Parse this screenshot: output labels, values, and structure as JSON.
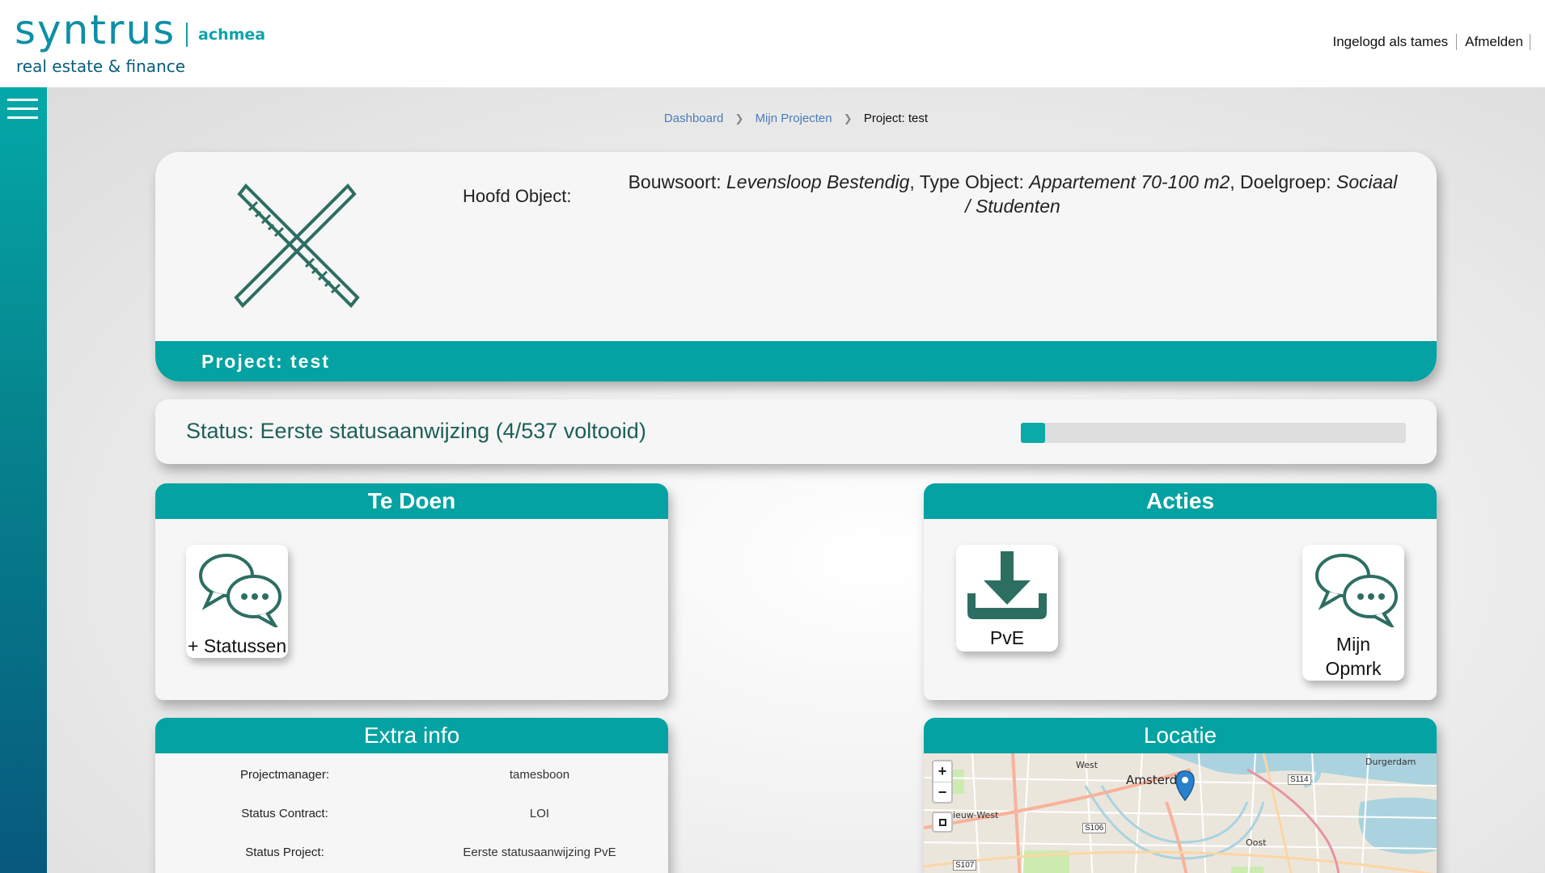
{
  "header": {
    "brand": "syntrus",
    "partner": "achmea",
    "tagline": "real estate & finance",
    "logged_in": "Ingelogd als tames",
    "logout": "Afmelden"
  },
  "breadcrumb": {
    "items": [
      "Dashboard",
      "Mijn Projecten"
    ],
    "current": "Project: test"
  },
  "project": {
    "icon": "crossed-rulers-icon",
    "hoofd_label": "Hoofd Object:",
    "bouwsoort_label": "Bouwsoort: ",
    "bouwsoort": "Levensloop Bestendig",
    "type_label": ", Type Object: ",
    "type_object": "Appartement 70-100 m2",
    "doelgroep_label": ", Doelgroep: ",
    "doelgroep": "Sociaal / Studenten",
    "name": "Project: test"
  },
  "status": {
    "text": "Status: Eerste statusaanwijzing (4/537 voltooid)",
    "progress_fraction": 0.0074
  },
  "todo": {
    "title": "Te Doen",
    "tiles": [
      {
        "label": "+ Statussen",
        "icon": "chat-bubbles-icon"
      }
    ]
  },
  "acties": {
    "title": "Acties",
    "tiles": [
      {
        "label": "PvE",
        "icon": "download-icon"
      },
      {
        "label": "Mijn Opmrk",
        "icon": "chat-bubbles-icon"
      }
    ]
  },
  "extra": {
    "title": "Extra info",
    "rows": [
      {
        "key": "Projectmanager:",
        "value": "tamesboon"
      },
      {
        "key": "Status Contract:",
        "value": "LOI"
      },
      {
        "key": "Status Project:",
        "value": "Eerste statusaanwijzing PvE"
      }
    ]
  },
  "locatie": {
    "title": "Locatie",
    "zoom_in": "+",
    "zoom_out": "−",
    "labels": {
      "west": "West",
      "amsterdam": "Amsterd",
      "durgerdam": "Durgerdam",
      "nieuw_west": "ieuw-West",
      "oost": "Oost",
      "s114": "S114",
      "s106": "S106",
      "s107": "S107"
    }
  },
  "colors": {
    "teal": "#04a2a2",
    "dark_green": "#2d6e62",
    "status_text": "#1d5f57"
  }
}
